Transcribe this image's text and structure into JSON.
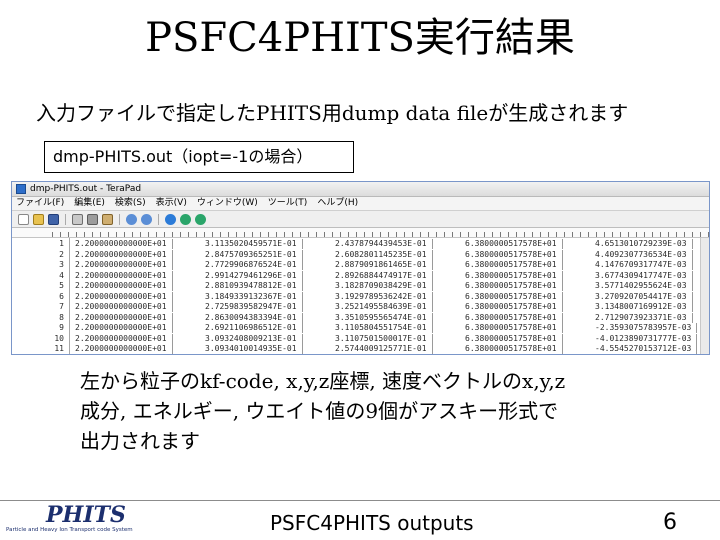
{
  "slide": {
    "title": "PSFC4PHITS実行結果",
    "subtitle": "入力ファイルで指定したPHITS用dump data fileが生成されます",
    "file_label": "dmp-PHITS.out（iopt=-1の場合）",
    "description_line1": "左から粒子のkf-code, x,y,z座標, 速度ベクトルのx,y,z",
    "description_line2": "成分, エネルギー, ウエイト値の9個がアスキー形式で",
    "description_line3": "出力されます",
    "footer_text": "PSFC4PHITS outputs",
    "page_number": "6"
  },
  "logo": {
    "name": "PHITS",
    "tagline": "Particle and Heavy Ion Transport code System"
  },
  "editor": {
    "window_title": "dmp-PHITS.out - TeraPad",
    "menu": [
      "ファイル(F)",
      "編集(E)",
      "検索(S)",
      "表示(V)",
      "ウィンドウ(W)",
      "ツール(T)",
      "ヘルプ(H)"
    ],
    "toolbar_icons": [
      "new-file-icon",
      "open-folder-icon",
      "save-icon",
      "cut-icon",
      "copy-icon",
      "paste-icon",
      "undo-icon",
      "redo-icon",
      "search-icon",
      "find-next-icon",
      "find-prev-icon"
    ],
    "rows": [
      {
        "n": "1",
        "c": [
          "2.2000000000000E+01",
          "3.1135020459571E-01",
          "2.4378794439453E-01",
          "6.3800000517578E+01",
          "4.6513010729239E-03"
        ]
      },
      {
        "n": "2",
        "c": [
          "2.2000000000000E+01",
          "2.8475709365251E-01",
          "2.6082801145235E-01",
          "6.3800000517578E+01",
          "4.4092307736534E-03"
        ]
      },
      {
        "n": "3",
        "c": [
          "2.2000000000000E+01",
          "2.7729906876524E-01",
          "2.8879091861465E-01",
          "6.3800000517578E+01",
          "4.1476709317747E-03"
        ]
      },
      {
        "n": "4",
        "c": [
          "2.2000000000000E+01",
          "2.9914279461296E-01",
          "2.8926884474917E-01",
          "6.3800000517578E+01",
          "3.6774309417747E-03"
        ]
      },
      {
        "n": "5",
        "c": [
          "2.2000000000000E+01",
          "2.8810939478812E-01",
          "3.1828709038429E-01",
          "6.3800000517578E+01",
          "3.5771402955624E-03"
        ]
      },
      {
        "n": "6",
        "c": [
          "2.2000000000000E+01",
          "3.1849339132367E-01",
          "3.1929789536242E-01",
          "6.3800000517578E+01",
          "3.2709207054417E-03"
        ]
      },
      {
        "n": "7",
        "c": [
          "2.2000000000000E+01",
          "2.7259839582947E-01",
          "3.2521495584639E-01",
          "6.3800000517578E+01",
          "3.1348007169912E-03"
        ]
      },
      {
        "n": "8",
        "c": [
          "2.2000000000000E+01",
          "2.8630094383394E-01",
          "3.3510595565474E-01",
          "6.3800000517578E+01",
          "2.7129073923371E-03"
        ]
      },
      {
        "n": "9",
        "c": [
          "2.2000000000000E+01",
          "2.6921106986512E-01",
          "3.1105804551754E-01",
          "6.3800000517578E+01",
          "-2.3593075783957E-03"
        ]
      },
      {
        "n": "10",
        "c": [
          "2.2000000000000E+01",
          "3.0932408009213E-01",
          "3.1107501500017E-01",
          "6.3800000517578E+01",
          "-4.0123890731777E-03"
        ]
      },
      {
        "n": "11",
        "c": [
          "2.2000000000000E+01",
          "3.0934010014935E-01",
          "2.5744009125771E-01",
          "6.3800000517578E+01",
          "-4.5545270153712E-03"
        ]
      }
    ]
  }
}
